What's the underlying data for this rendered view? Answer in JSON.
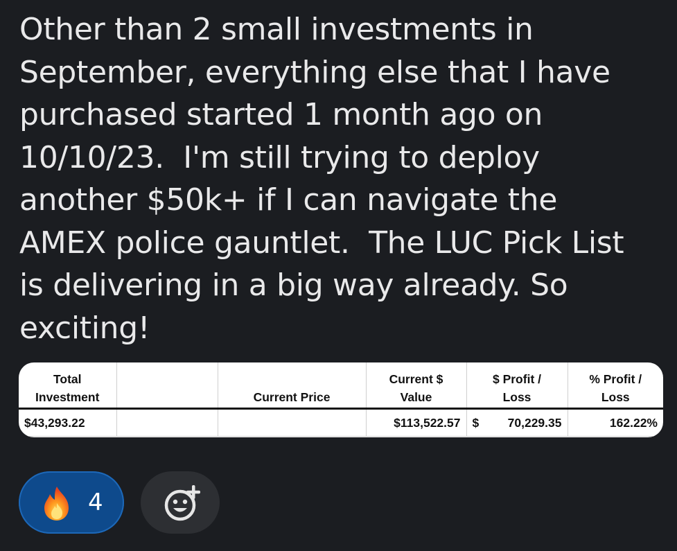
{
  "message": {
    "lines": [
      "Other than 2 small investments in",
      "September, everything else that I have",
      "purchased started 1 month ago on",
      "10/10/23.  I'm still trying to deploy",
      "another $50k+ if I can navigate the",
      "AMEX police gauntlet.  The LUC Pick List",
      "is delivering in a big way already. So",
      "exciting!"
    ]
  },
  "table": {
    "headers": [
      "Total\nInvestment",
      "",
      "Current Price",
      "Current $\nValue",
      "$ Profit /\nLoss",
      "% Profit /\nLoss"
    ],
    "row": {
      "total_investment": "$43,293.22",
      "blank": "",
      "current_price": "",
      "current_value": "$113,522.57",
      "profit_symbol": "$",
      "profit_amount": "70,229.35",
      "profit_percent": "162.22%"
    }
  },
  "reactions": {
    "fire": {
      "icon": "fire-emoji-icon",
      "count": "4"
    },
    "add_reaction": {
      "icon": "add-emoji-icon"
    }
  },
  "colors": {
    "background": "#1b1d21",
    "text": "#e9e9ea",
    "reaction_pill": "#0e4a8c",
    "add_button": "#2d2f33"
  }
}
